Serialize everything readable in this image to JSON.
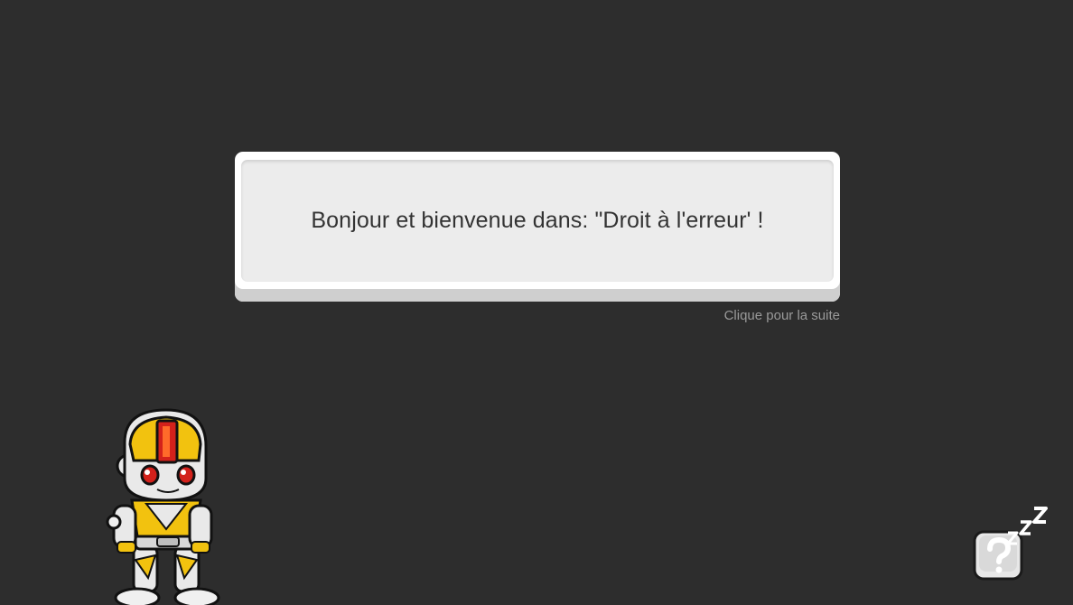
{
  "dialog": {
    "message": "Bonjour et bienvenue dans: \"Droit à l'erreur' !",
    "continue_hint": "Clique pour la suite"
  },
  "characters": {
    "robot": "robot-character-icon"
  },
  "help": {
    "icon": "question-mark-icon",
    "sleep_icon": "zzz-sleep-icon"
  },
  "colors": {
    "background": "#2d2d2d",
    "dialog_face": "#ececec",
    "accent_yellow": "#f2c20f",
    "accent_red": "#d3211b"
  }
}
